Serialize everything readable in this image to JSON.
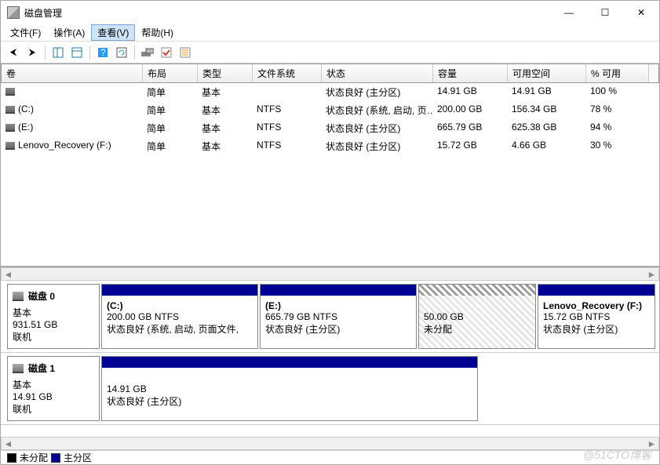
{
  "title": "磁盘管理",
  "menus": {
    "file": "文件(F)",
    "action": "操作(A)",
    "view": "查看(V)",
    "help": "帮助(H)"
  },
  "winctl": {
    "min": "—",
    "max": "☐",
    "close": "✕"
  },
  "toolbar_icons": [
    "arrow-left-icon",
    "arrow-right-icon",
    "sep",
    "panel-icon",
    "props-icon",
    "sep",
    "help-icon",
    "refresh-icon",
    "sep",
    "disk-list-icon",
    "check-icon",
    "settings-icon"
  ],
  "columns": [
    "卷",
    "布局",
    "类型",
    "文件系统",
    "状态",
    "容量",
    "可用空间",
    "% 可用"
  ],
  "volumes": [
    {
      "name": "",
      "layout": "简单",
      "type": "基本",
      "fs": "",
      "status": "状态良好 (主分区)",
      "capacity": "14.91 GB",
      "free": "14.91 GB",
      "pct": "100 %"
    },
    {
      "name": "(C:)",
      "layout": "简单",
      "type": "基本",
      "fs": "NTFS",
      "status": "状态良好 (系统, 启动, 页…",
      "capacity": "200.00 GB",
      "free": "156.34 GB",
      "pct": "78 %"
    },
    {
      "name": "(E:)",
      "layout": "简单",
      "type": "基本",
      "fs": "NTFS",
      "status": "状态良好 (主分区)",
      "capacity": "665.79 GB",
      "free": "625.38 GB",
      "pct": "94 %"
    },
    {
      "name": "Lenovo_Recovery (F:)",
      "layout": "简单",
      "type": "基本",
      "fs": "NTFS",
      "status": "状态良好 (主分区)",
      "capacity": "15.72 GB",
      "free": "4.66 GB",
      "pct": "30 %"
    }
  ],
  "disks": [
    {
      "name": "磁盘 0",
      "type": "基本",
      "size": "931.51 GB",
      "state": "联机",
      "parts": [
        {
          "name": "(C:)",
          "line2": "200.00 GB NTFS",
          "line3": "状态良好 (系统, 启动, 页面文件,",
          "kind": "primary",
          "flex": 200
        },
        {
          "name": "(E:)",
          "line2": "665.79 GB NTFS",
          "line3": "状态良好 (主分区)",
          "kind": "primary",
          "flex": 200
        },
        {
          "name": "",
          "line2": "50.00 GB",
          "line3": "未分配",
          "kind": "unalloc",
          "flex": 150
        },
        {
          "name": "Lenovo_Recovery  (F:)",
          "line2": "15.72 GB NTFS",
          "line3": "状态良好 (主分区)",
          "kind": "primary",
          "flex": 150
        }
      ]
    },
    {
      "name": "磁盘 1",
      "type": "基本",
      "size": "14.91 GB",
      "state": "联机",
      "parts": [
        {
          "name": "",
          "line2": "14.91 GB",
          "line3": "状态良好 (主分区)",
          "kind": "primary",
          "flex": 480
        }
      ]
    }
  ],
  "legend": {
    "unalloc": "未分配",
    "primary": "主分区"
  },
  "watermark": "@51CTO博客"
}
